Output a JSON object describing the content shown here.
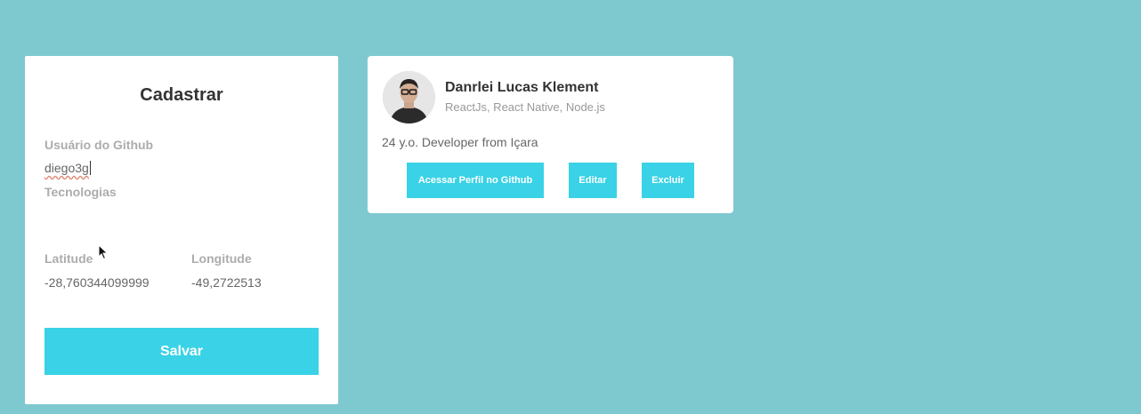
{
  "form": {
    "title": "Cadastrar",
    "github_user_label": "Usuário do Github",
    "github_user_value": "diego3g",
    "techs_label": "Tecnologias",
    "techs_value": "",
    "latitude_label": "Latitude",
    "latitude_value": "-28,760344099999",
    "longitude_label": "Longitude",
    "longitude_value": "-49,2722513",
    "save_label": "Salvar"
  },
  "dev": {
    "name": "Danrlei Lucas Klement",
    "techs": "ReactJs, React Native, Node.js",
    "bio": "24 y.o. Developer from Içara",
    "github_button": "Acessar Perfil no Github",
    "edit_button": "Editar",
    "delete_button": "Excluir"
  },
  "colors": {
    "background": "#7ec8d0",
    "accent": "#3ad2e6",
    "label": "#acacac"
  }
}
